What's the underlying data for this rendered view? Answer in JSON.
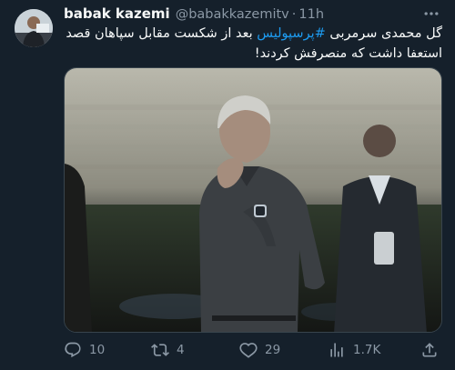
{
  "user": {
    "display_name": "babak kazemi",
    "handle": "@babakkazemitv",
    "separator": "·",
    "time": "11h"
  },
  "tweet": {
    "line1_before": "گل محمدی سرمربی ",
    "hashtag": "#پرسپولیس",
    "line1_after": " بعد از شکست مقابل سپاهان قصد",
    "line2": "استعفا داشت که منصرفش کردند!"
  },
  "actions": {
    "replies": "10",
    "retweets": "4",
    "likes": "29",
    "views": "1.7K"
  },
  "icons": {
    "more": "more-horizontal-icon",
    "reply": "reply-icon",
    "retweet": "retweet-icon",
    "like": "heart-icon",
    "views": "analytics-icon",
    "share": "share-icon"
  },
  "colors": {
    "background": "#15202b",
    "text": "#f7f9f9",
    "secondary": "#8b98a5",
    "hashtag": "#1d9bf0"
  }
}
